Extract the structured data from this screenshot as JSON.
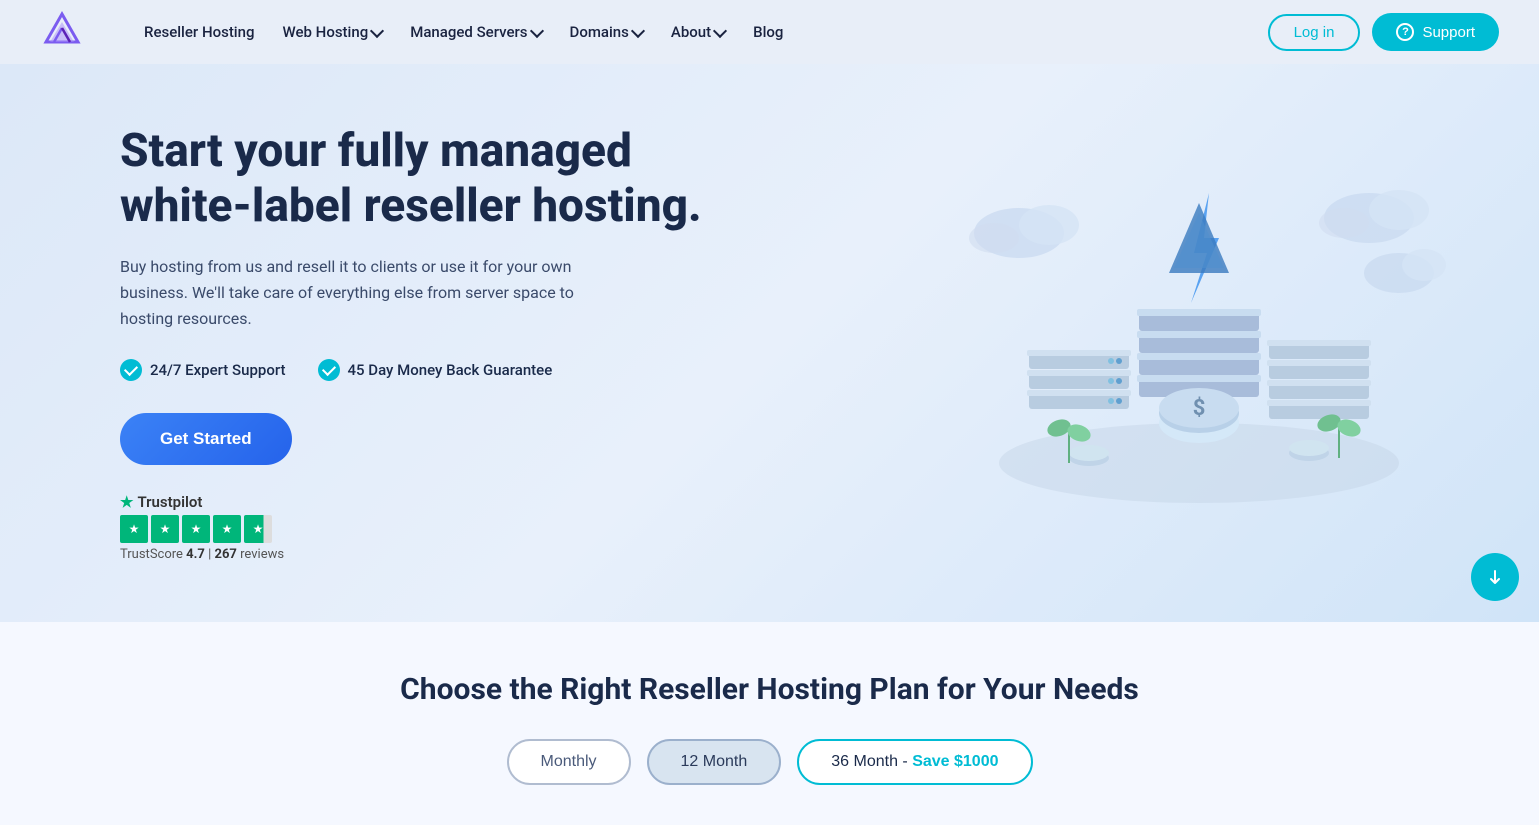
{
  "navbar": {
    "logo_alt": "Reseller Club Logo",
    "links": [
      {
        "label": "Reseller Hosting",
        "has_dropdown": false
      },
      {
        "label": "Web Hosting",
        "has_dropdown": true
      },
      {
        "label": "Managed Servers",
        "has_dropdown": true
      },
      {
        "label": "Domains",
        "has_dropdown": true
      },
      {
        "label": "About",
        "has_dropdown": true
      },
      {
        "label": "Blog",
        "has_dropdown": false
      }
    ],
    "login_label": "Log in",
    "support_label": "Support"
  },
  "hero": {
    "title": "Start your fully managed white-label reseller hosting.",
    "subtitle": "Buy hosting from us and resell it to clients or use it for your own business. We'll take care of everything else from server space to hosting resources.",
    "badge1": "24/7 Expert Support",
    "badge2": "45 Day Money Back Guarantee",
    "cta_label": "Get Started",
    "trustpilot": {
      "brand": "Trustpilot",
      "score_label": "TrustScore",
      "score": "4.7",
      "separator": "|",
      "reviews_count": "267",
      "reviews_label": "reviews"
    }
  },
  "plans": {
    "title": "Choose the Right Reseller Hosting Plan for Your Needs",
    "billing_options": [
      {
        "label": "Monthly",
        "style": "outline"
      },
      {
        "label": "12 Month",
        "style": "filled"
      },
      {
        "label": "36 Month",
        "suffix": " - ",
        "save_text": "Save $1000",
        "style": "teal"
      }
    ]
  }
}
